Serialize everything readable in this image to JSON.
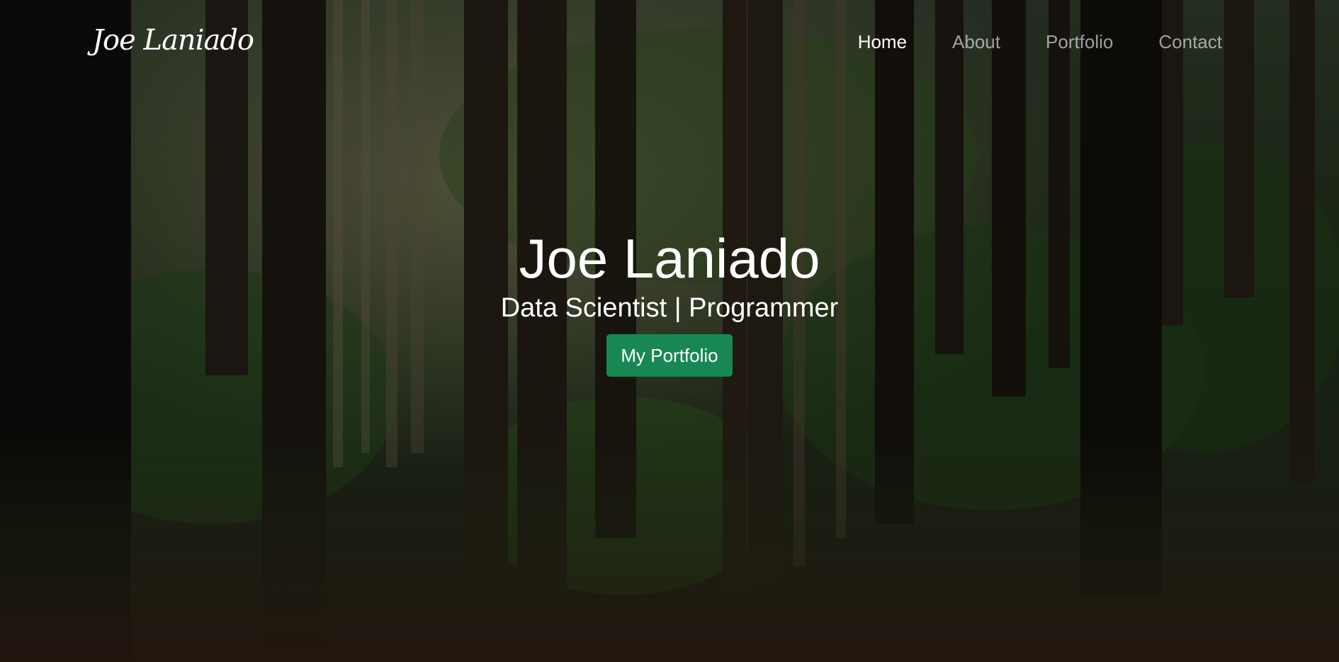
{
  "brand": {
    "name": "Joe Laniado"
  },
  "nav": {
    "items": [
      {
        "label": "Home",
        "active": true
      },
      {
        "label": "About",
        "active": false
      },
      {
        "label": "Portfolio",
        "active": false
      },
      {
        "label": "Contact",
        "active": false
      }
    ]
  },
  "hero": {
    "title": "Joe Laniado",
    "subtitle": "Data Scientist | Programmer",
    "cta_label": "My Portfolio",
    "background": "forest-photo"
  },
  "colors": {
    "cta_background": "#198754",
    "text": "#ffffff",
    "nav_inactive": "rgba(255,255,255,0.6)"
  }
}
